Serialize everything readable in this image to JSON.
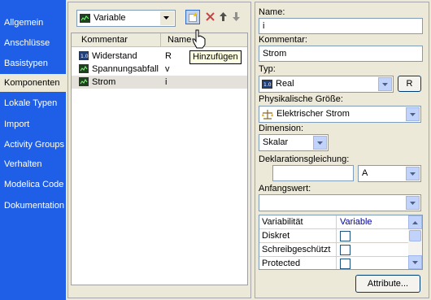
{
  "sidebar": {
    "items": [
      {
        "label": "Allgemein"
      },
      {
        "label": "Anschlüsse"
      },
      {
        "label": "Basistypen"
      },
      {
        "label": "Komponenten",
        "selected": true
      },
      {
        "label": "Lokale Typen"
      },
      {
        "label": "Import"
      },
      {
        "label": "Activity Groups"
      },
      {
        "label": "Verhalten"
      },
      {
        "label": "Modelica Code"
      },
      {
        "label": "Dokumentation"
      }
    ]
  },
  "left": {
    "type_combo": "Variable",
    "tooltip": "Hinzufügen",
    "columns": {
      "comment": "Kommentar",
      "name": "Name"
    },
    "rows": [
      {
        "comment": "Widerstand",
        "name": "R"
      },
      {
        "comment": "Spannungsabfall",
        "name": "v"
      },
      {
        "comment": "Strom",
        "name": "i",
        "selected": true
      }
    ]
  },
  "right": {
    "name_label": "Name:",
    "name_value": "i",
    "comment_label": "Kommentar:",
    "comment_value": "Strom",
    "type_label": "Typ:",
    "type_value": "Real",
    "type_button": "R",
    "physical_label": "Physikalische Größe:",
    "physical_value": "Elektrischer Strom",
    "dimension_label": "Dimension:",
    "dimension_value": "Skalar",
    "decl_label": "Deklarationsgleichung:",
    "decl_value": "",
    "decl_unit": "A",
    "initial_label": "Anfangswert:",
    "initial_value": "",
    "props": {
      "header": {
        "prop": "Variabilität",
        "value": "Variable"
      },
      "rows": [
        {
          "prop": "Diskret",
          "checked": false
        },
        {
          "prop": "Schreibgeschützt",
          "checked": false
        },
        {
          "prop": "Protected",
          "checked": false
        }
      ]
    },
    "attributes_button": "Attribute..."
  },
  "colors": {
    "sidebar_bg": "#1f5fe8",
    "selection": "#e3e1da",
    "accent_text": "#00009c",
    "tooltip_bg": "#ffffe1"
  }
}
